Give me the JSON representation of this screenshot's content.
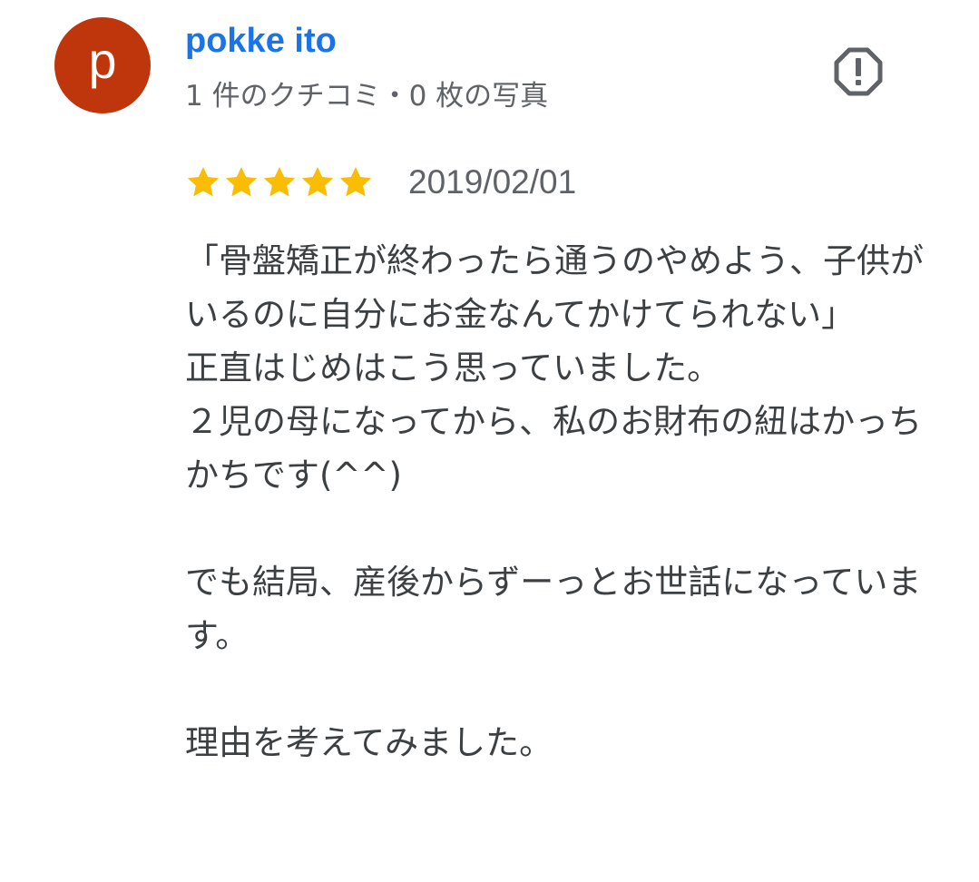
{
  "author": {
    "avatar_letter": "p",
    "avatar_color": "#bf360c",
    "name": "pokke ito",
    "name_color": "#1a73e8",
    "meta": "1 件のクチコミ・0 枚の写真"
  },
  "report": {
    "icon": "report-flag-octagon-icon"
  },
  "review": {
    "rating": 5,
    "max_rating": 5,
    "star_color": "#fbbc04",
    "date": "2019/02/01",
    "text": "「骨盤矯正が終わったら通うのやめよう、子供がいるのに自分にお金なんてかけてられない」\n正直はじめはこう思っていました。\n２児の母になってから、私のお財布の紐はかっちかちです(^^)\n\nでも結局、産後からずーっとお世話になっています。\n\n理由を考えてみました。"
  }
}
